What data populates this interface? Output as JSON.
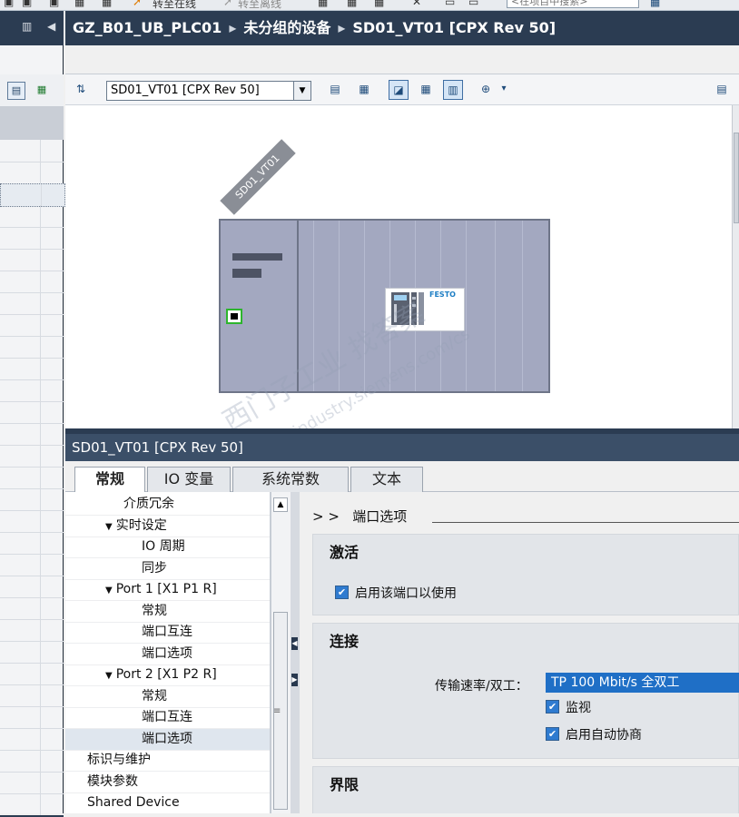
{
  "top_toolbar": {
    "go_online": "转至在线",
    "go_offline": "转至离线",
    "search_placeholder": "<在项目中搜索>"
  },
  "editor": {
    "breadcrumb": [
      "GZ_B01_UB_PLC01",
      "未分组的设备",
      "SD01_VT01 [CPX Rev 50]"
    ],
    "device_selector": "SD01_VT01 [CPX Rev 50]",
    "device_label": "SD01_VT01",
    "module_brand": "FESTO"
  },
  "watermark": {
    "line1": "西门子工业 找答案",
    "line2": "support.industry.siemens.com/cs"
  },
  "properties": {
    "title": "SD01_VT01 [CPX Rev 50]",
    "tabs": [
      "常规",
      "IO 变量",
      "系统常数",
      "文本"
    ],
    "tree": [
      {
        "label": "介质冗余",
        "indent": 2
      },
      {
        "label": "实时设定",
        "indent": 1,
        "caret": "▼"
      },
      {
        "label": "IO 周期",
        "indent": 3
      },
      {
        "label": "同步",
        "indent": 3
      },
      {
        "label": "Port 1 [X1 P1 R]",
        "indent": 1,
        "caret": "▼"
      },
      {
        "label": "常规",
        "indent": 3
      },
      {
        "label": "端口互连",
        "indent": 3
      },
      {
        "label": "端口选项",
        "indent": 3
      },
      {
        "label": "Port 2 [X1 P2 R]",
        "indent": 1,
        "caret": "▼"
      },
      {
        "label": "常规",
        "indent": 3
      },
      {
        "label": "端口互连",
        "indent": 3
      },
      {
        "label": "端口选项",
        "indent": 3,
        "selected": true
      },
      {
        "label": "标识与维护",
        "indent": 0
      },
      {
        "label": "模块参数",
        "indent": 0
      },
      {
        "label": "Shared Device",
        "indent": 0
      }
    ],
    "content": {
      "breadcrumb_arrows": "> >",
      "section_title": "端口选项",
      "activation": {
        "title": "激活",
        "enable_port_label": "启用该端口以使用",
        "enable_port_checked": true
      },
      "connection": {
        "title": "连接",
        "speed_label": "传输速率/双工：",
        "speed_value": "TP 100 Mbit/s 全双工",
        "monitor_label": "监视",
        "monitor_checked": true,
        "autoneg_label": "启用自动协商",
        "autoneg_checked": true
      },
      "limits": {
        "title": "界限"
      }
    }
  }
}
